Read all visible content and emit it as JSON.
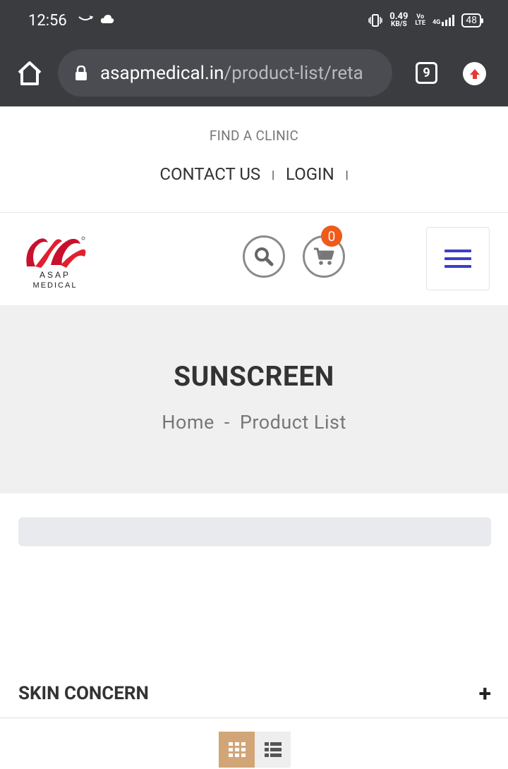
{
  "status_bar": {
    "time": "12:56",
    "net_speed": "0.49",
    "net_unit": "KB/S",
    "volte_top": "Vo",
    "volte_bottom": "LTE",
    "network": "4G",
    "battery": "48"
  },
  "browser": {
    "url_domain": "asapmedical.in",
    "url_path": "/product-list/reta",
    "tab_count": "9"
  },
  "top_links": {
    "find_clinic": "FIND A CLINIC",
    "contact_us": "CONTACT US",
    "login": "LOGIN",
    "separator": "|"
  },
  "header": {
    "logo_text_1": "ASAP",
    "logo_text_2": "MEDICAL",
    "cart_count": "0"
  },
  "banner": {
    "title": "SUNSCREEN",
    "breadcrumb_home": "Home",
    "breadcrumb_sep": "-",
    "breadcrumb_current": "Product List"
  },
  "filters": {
    "skin_concern_label": "SKIN CONCERN",
    "expand_symbol": "+"
  },
  "colors": {
    "chrome_bg": "#3a3c40",
    "menu_accent": "#3b3ec7",
    "cart_badge": "#f05a1a",
    "grid_view_active": "#d2a577",
    "banner_bg": "#f0f0f0"
  }
}
